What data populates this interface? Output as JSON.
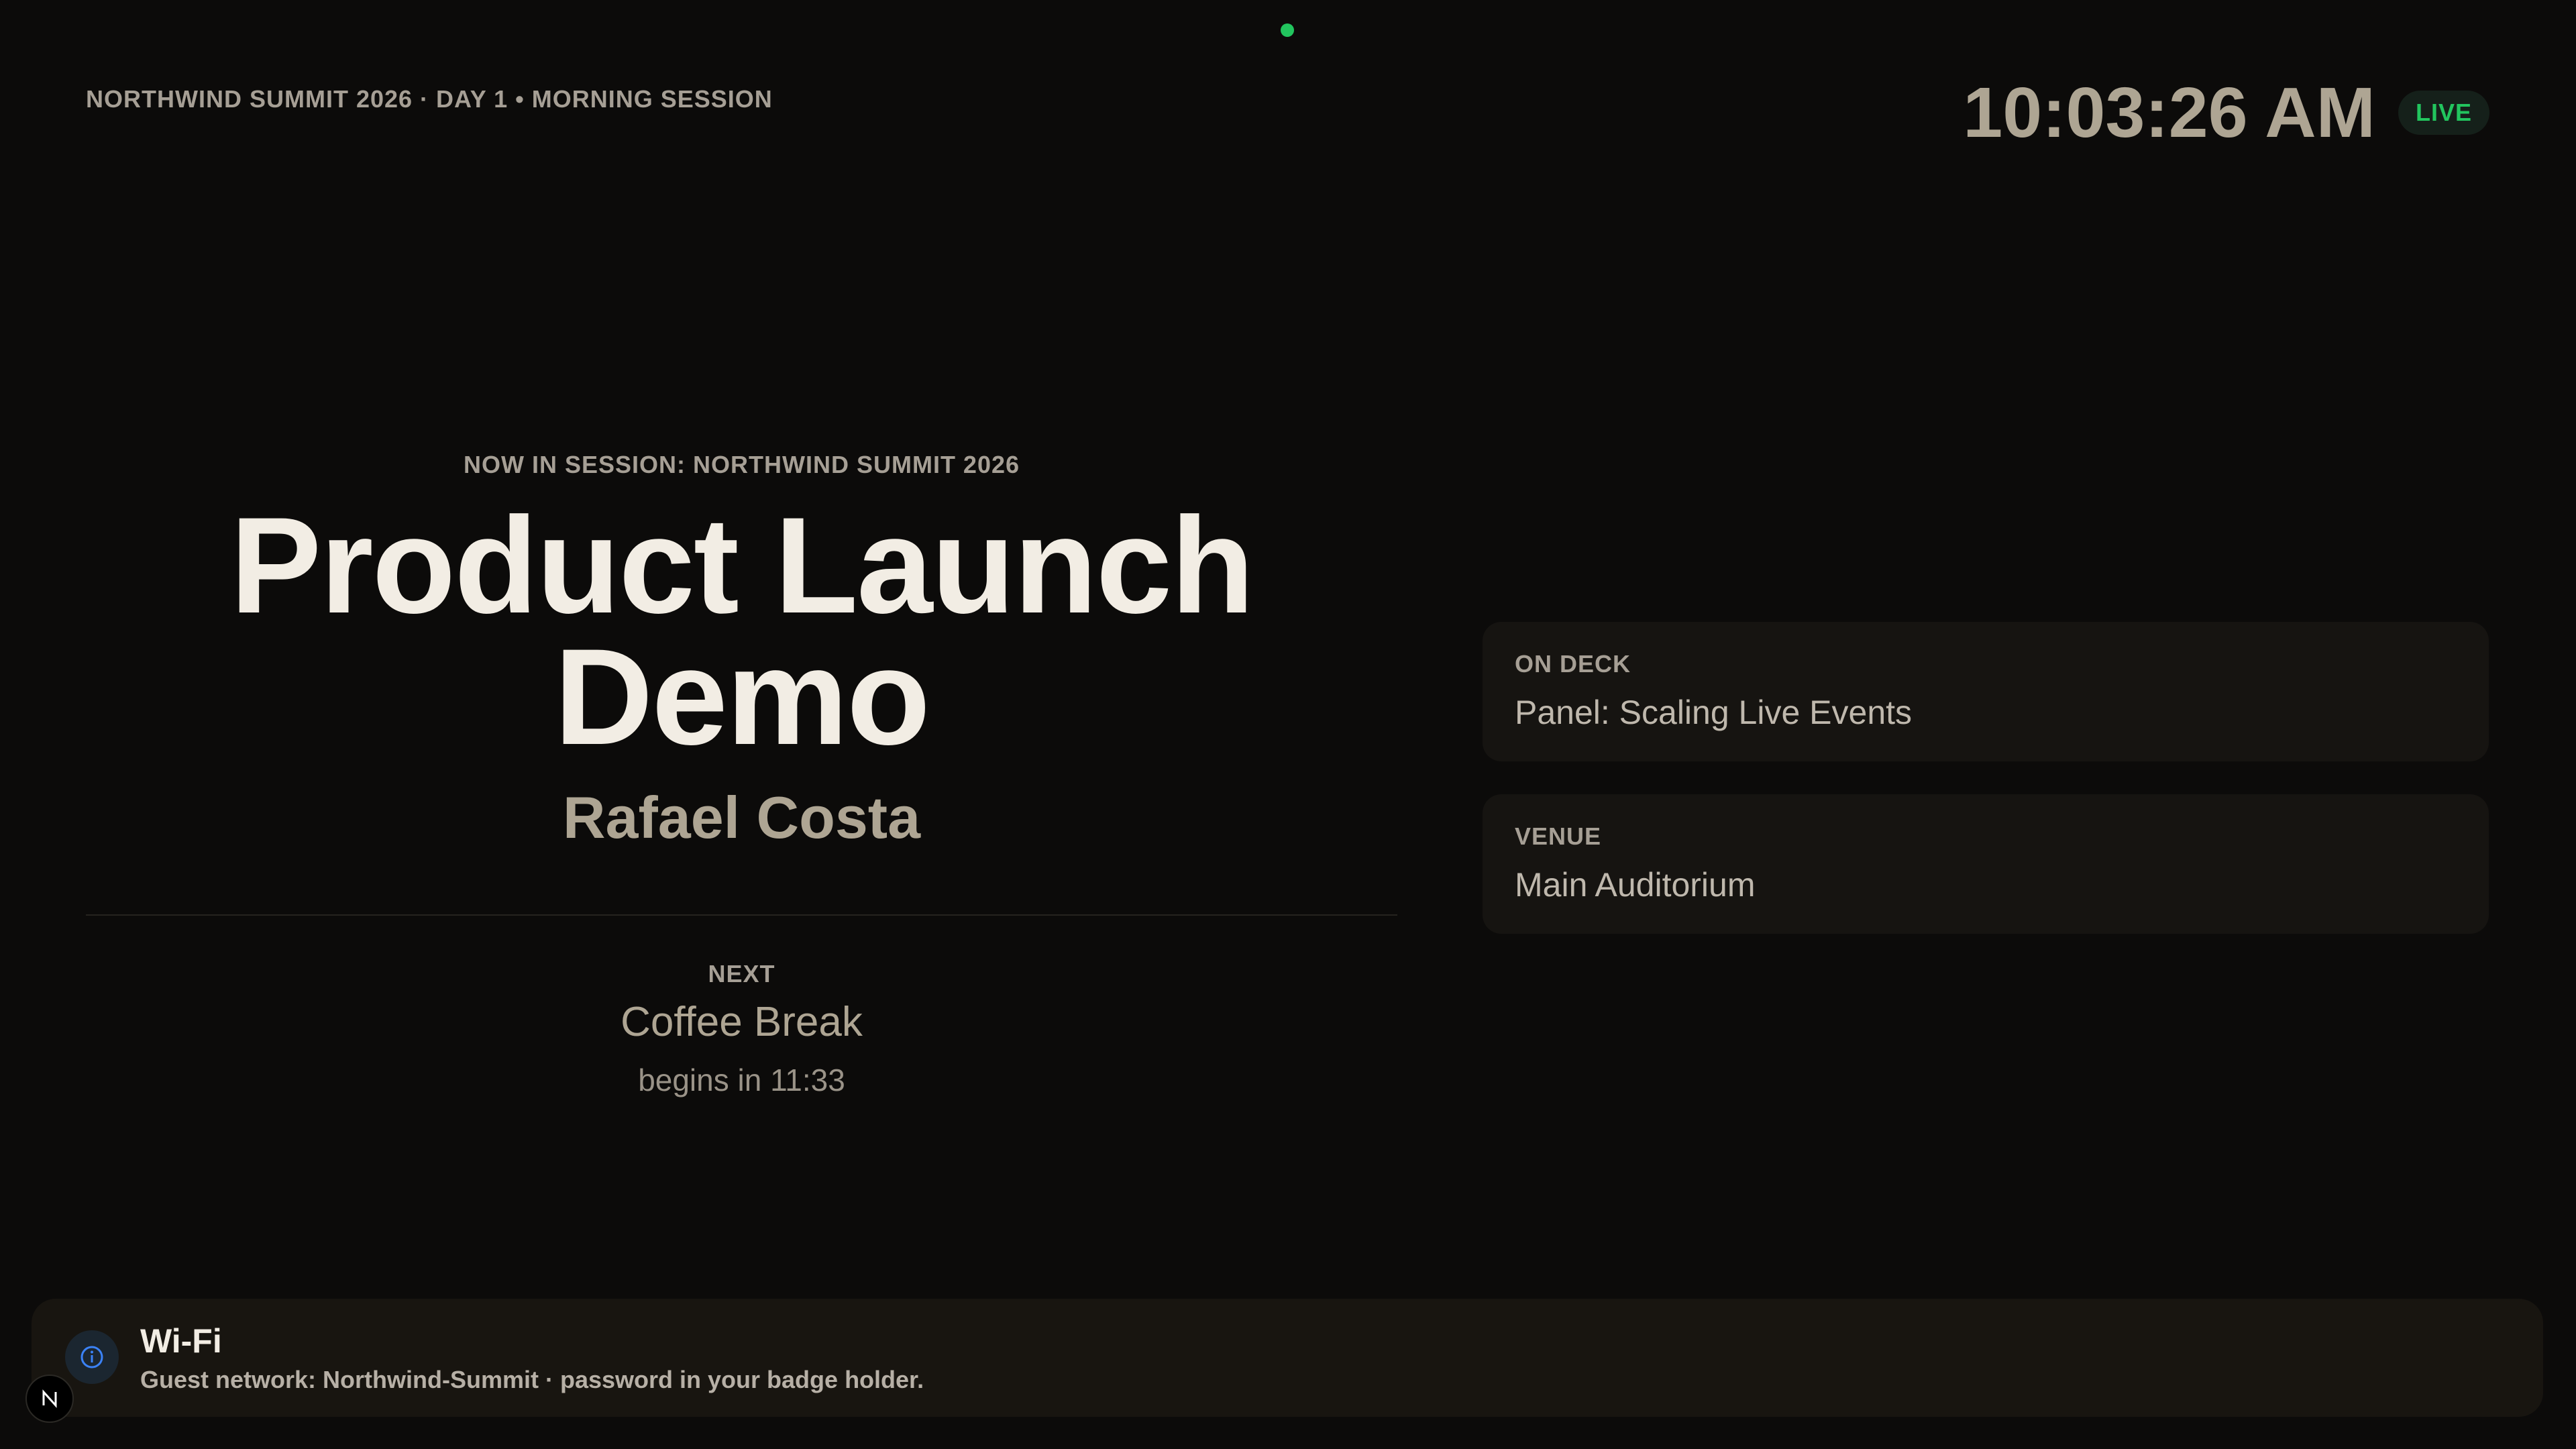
{
  "header": {
    "event_line": "NORTHWIND SUMMIT 2026 · DAY 1 • MORNING SESSION",
    "clock": "10:03:26 AM",
    "live_label": "LIVE"
  },
  "session": {
    "now_label": "NOW IN SESSION: NORTHWIND SUMMIT 2026",
    "title_line1": "Product Launch",
    "title_line2": "Demo",
    "speaker": "Rafael Costa"
  },
  "next": {
    "label": "NEXT",
    "title": "Coffee Break",
    "countdown": "begins in 11:33"
  },
  "cards": {
    "on_deck": {
      "label": "ON DECK",
      "value": "Panel: Scaling Live Events"
    },
    "venue": {
      "label": "VENUE",
      "value": "Main Auditorium"
    }
  },
  "notice": {
    "icon": "info-icon",
    "title": "Wi-Fi",
    "text": "Guest network: Northwind-Summit · password in your badge holder."
  },
  "colors": {
    "background": "#0c0b0a",
    "accent_live": "#22c55e",
    "info_blue": "#3b82f6"
  }
}
